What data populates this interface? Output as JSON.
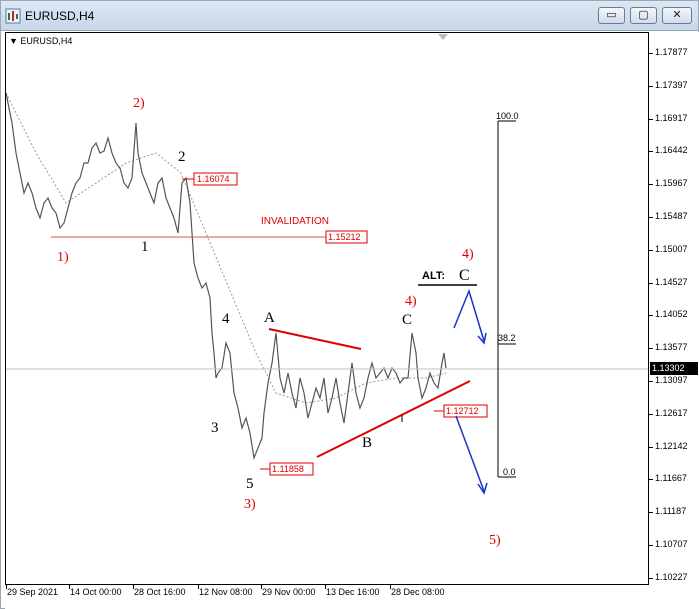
{
  "window": {
    "title": "EURUSD,H4",
    "minimize_glyph": "▭",
    "maximize_glyph": "▢",
    "close_glyph": "✕"
  },
  "chart_symbol": "EURUSD,H4",
  "price_axis_ticks": [
    "1.17877",
    "1.17397",
    "1.16917",
    "1.16442",
    "1.15967",
    "1.15487",
    "1.15007",
    "1.14527",
    "1.14052",
    "1.13577",
    "1.13097",
    "1.12617",
    "1.12142",
    "1.11667",
    "1.11187",
    "1.10707",
    "1.10227"
  ],
  "current_price": "1.13302",
  "time_axis_ticks": [
    "29 Sep 2021",
    "14 Oct 00:00",
    "28 Oct 16:00",
    "12 Nov 08:00",
    "29 Nov 00:00",
    "13 Dec 16:00",
    "28 Dec 08:00"
  ],
  "price_labels": {
    "high_2": "1.16074",
    "invalidation": "1.15212",
    "low_5": "1.11858",
    "current_support": "1.12712"
  },
  "invalidation_text": "INVALIDATION",
  "wave_labels": {
    "w2_red": "2)",
    "w1_red": "1)",
    "w3_red": "3)",
    "w4_red_top": "4)",
    "w4_red_c": "4)",
    "w5_red": "5)",
    "w1_black": "1",
    "w2_black": "2",
    "w3_black": "3",
    "w4_black": "4",
    "w5_black": "5",
    "wA": "A",
    "wB": "B",
    "wC": "C",
    "alt_prefix": "ALT:",
    "alt_c": "C"
  },
  "fib_levels": {
    "top": "100.0",
    "mid": "38.2",
    "bottom": "0.0"
  },
  "colors": {
    "wave_red": "#e00000",
    "wave_black": "#000000",
    "arrow_blue": "#1a33cc",
    "price_series": "#555555",
    "ma_dotted": "#999999",
    "invalidation_line": "#e05050"
  },
  "chart_data": {
    "type": "line",
    "title": "EURUSD,H4",
    "xlabel": "",
    "ylabel": "",
    "x_ticks": [
      "29 Sep 2021",
      "14 Oct 00:00",
      "28 Oct 16:00",
      "12 Nov 08:00",
      "29 Nov 00:00",
      "13 Dec 16:00",
      "28 Dec 08:00"
    ],
    "ylim": [
      1.10227,
      1.17877
    ],
    "series": [
      {
        "values": [
          1.172,
          1.165,
          1.16,
          1.158,
          1.156,
          1.153,
          1.155,
          1.157,
          1.159,
          1.161,
          1.163,
          1.162,
          1.16,
          1.161,
          1.163,
          1.168,
          1.165,
          1.162,
          1.161,
          1.159,
          1.16,
          1.158,
          1.155,
          1.152,
          1.145,
          1.14,
          1.136,
          1.13,
          1.127,
          1.131,
          1.129,
          1.126,
          1.122,
          1.119,
          1.124,
          1.13,
          1.139,
          1.135,
          1.131,
          1.133,
          1.134,
          1.13,
          1.132,
          1.128,
          1.125,
          1.131,
          1.134,
          1.128,
          1.126,
          1.132,
          1.131,
          1.133,
          1.136,
          1.132,
          1.134,
          1.137,
          1.131,
          1.129,
          1.133,
          1.134
        ]
      }
    ]
  }
}
